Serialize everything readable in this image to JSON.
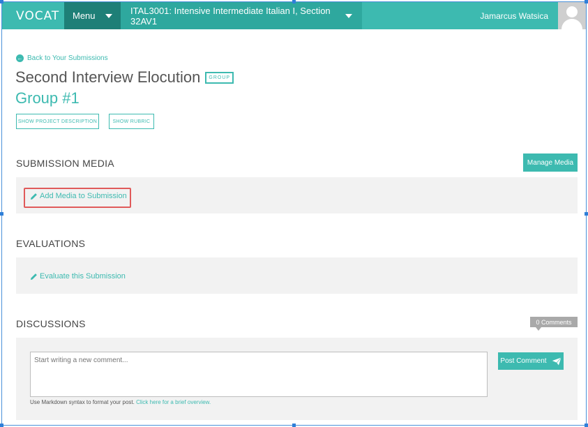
{
  "topbar": {
    "logo": "VOCAT",
    "menu_label": "Menu",
    "course_label": "ITAL3001: Intensive Intermediate Italian I, Section 32AV1",
    "user_name": "Jamarcus Watsica"
  },
  "header": {
    "back_link": "Back to Your Submissions",
    "title": "Second Interview Elocution",
    "badge": "GROUP",
    "group_name": "Group #1",
    "show_description": "SHOW PROJECT DESCRIPTION",
    "show_rubric": "SHOW RUBRIC"
  },
  "submission_media": {
    "title": "SUBMISSION MEDIA",
    "manage_button": "Manage Media",
    "add_link": "Add Media to Submission"
  },
  "evaluations": {
    "title": "EVALUATIONS",
    "evaluate_link": "Evaluate this Submission"
  },
  "discussions": {
    "title": "DISCUSSIONS",
    "comments_count": "0 Comments",
    "comment_placeholder": "Start writing a new comment...",
    "post_button": "Post Comment",
    "markdown_note": "Use Markdown syntax to format your post.",
    "markdown_link": "Click here for a brief overview."
  },
  "colors": {
    "accent": "#3dbab0",
    "menu_dark": "#1e7f77",
    "highlight": "#e05a5a"
  }
}
